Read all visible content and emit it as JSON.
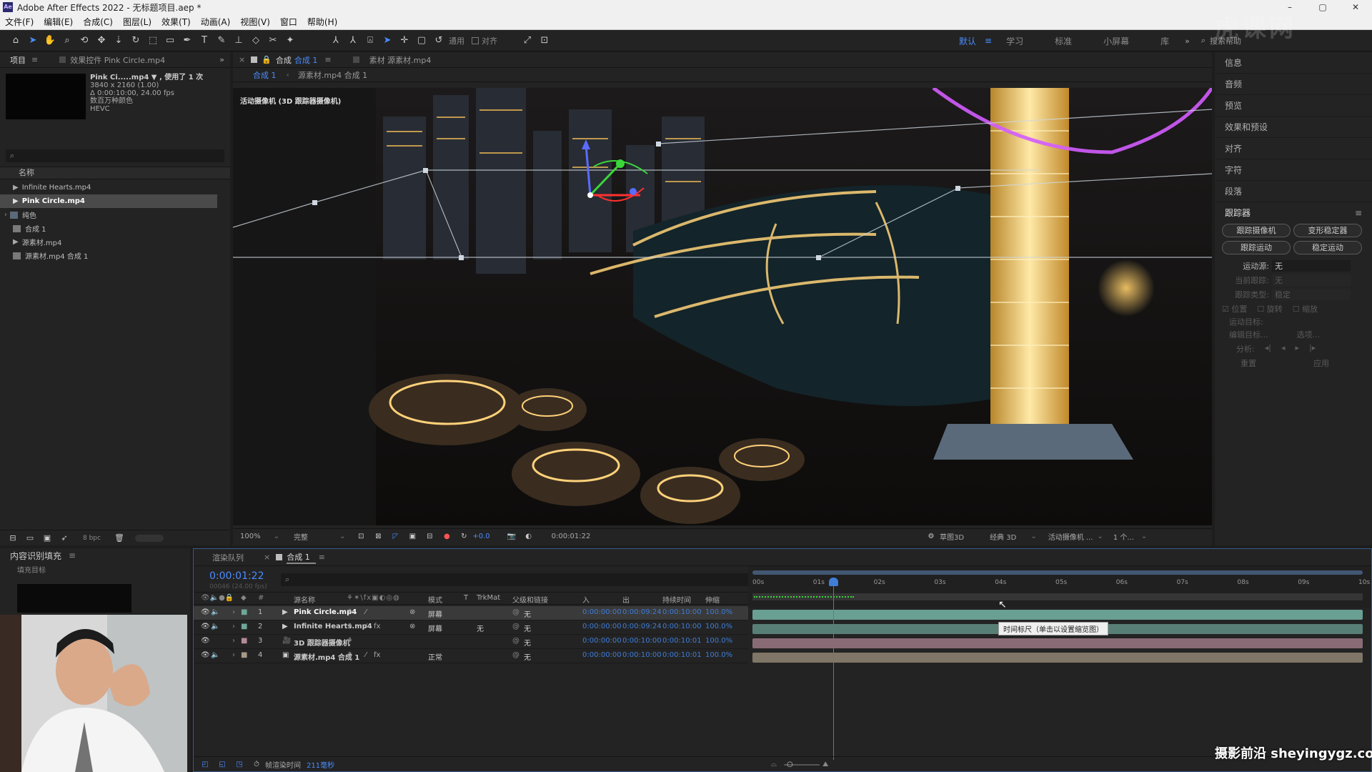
{
  "window": {
    "title": "Adobe After Effects 2022 - 无标题项目.aep *",
    "logo": "Ae",
    "controls": [
      "–",
      "▢",
      "✕"
    ]
  },
  "menu": [
    "文件(F)",
    "编辑(E)",
    "合成(C)",
    "图层(L)",
    "效果(T)",
    "动画(A)",
    "视图(V)",
    "窗口",
    "帮助(H)"
  ],
  "toolbar": {
    "snap_label": "通用",
    "align_label": "对齐",
    "workspaces": [
      "默认",
      "学习",
      "标准",
      "小屏幕",
      "库"
    ],
    "active_workspace": "默认",
    "search_placeholder": "搜索帮助"
  },
  "project": {
    "tab_label": "项目",
    "effects_tab": "效果控件 Pink Circle.mp4",
    "thumb_info": {
      "name": "Pink Ci.....mp4 ▼ , 使用了 1 次",
      "size": "3840 x 2160 (1.00)",
      "duration": "Δ 0:00:10:00, 24.00 fps",
      "colors": "数百万种颜色",
      "codec": "HEVC"
    },
    "search_placeholder": "",
    "column_name": "名称",
    "items": [
      {
        "label": "Infinite Hearts.mp4",
        "type": "footage",
        "selected": false
      },
      {
        "label": "Pink Circle.mp4",
        "type": "footage",
        "selected": true
      },
      {
        "label": "纯色",
        "type": "folder",
        "selected": false
      },
      {
        "label": "合成 1",
        "type": "comp",
        "selected": false
      },
      {
        "label": "源素材.mp4",
        "type": "footage",
        "selected": false
      },
      {
        "label": "源素材.mp4 合成 1",
        "type": "comp",
        "selected": false
      }
    ],
    "bpc": "8 bpc"
  },
  "composition": {
    "tab_comp": "合成",
    "tab_comp_name": "合成 1",
    "tab_footage": "素材 源素材.mp4",
    "breadcrumb": [
      "合成 1",
      "源素材.mp4 合成 1"
    ],
    "camera_label": "活动摄像机 (3D 跟踪器摄像机)",
    "zoom": "100%",
    "quality": "完整",
    "exposure": "+0.0",
    "timecode": "0:00:01:22",
    "renderer_draft": "草图3D",
    "renderer": "经典 3D",
    "view_camera": "活动摄像机 ...",
    "views": "1 个..."
  },
  "right_panel": {
    "items": [
      "信息",
      "音频",
      "预览",
      "效果和预设",
      "对齐",
      "字符",
      "段落"
    ],
    "tracker": {
      "title": "跟踪器",
      "buttons": [
        "跟踪摄像机",
        "变形稳定器",
        "跟踪运动",
        "稳定运动"
      ],
      "motion_source_label": "运动源:",
      "motion_source_value": "无",
      "current_track_label": "当前跟踪:",
      "current_track_value": "无",
      "track_type_label": "跟踪类型:",
      "track_type_value": "稳定",
      "checks": [
        "位置",
        "旋转",
        "缩放"
      ],
      "motion_target": "运动目标:",
      "edit_target": "编辑目标...",
      "options": "选项...",
      "analyze": "分析:",
      "reset": "重置",
      "apply": "应用"
    }
  },
  "content_fill": {
    "title": "内容识别填充",
    "fill_target": "填充目标"
  },
  "timeline": {
    "tab_render": "渲染队列",
    "tab_comp": "合成 1",
    "timecode": "0:00:01:22",
    "frame_info": "00046 (24.00 fps)",
    "search_placeholder": "",
    "headers": {
      "source_name": "源名称",
      "mode": "模式",
      "t": "T",
      "trkmat": "TrkMat",
      "parent": "父级和链接",
      "in": "入",
      "out": "出",
      "duration": "持续时间",
      "stretch": "伸缩"
    },
    "layers": [
      {
        "num": "1",
        "name": "Pink Circle.mp4",
        "mode": "屏幕",
        "trkmat": "",
        "parent": "无",
        "in": "0:00:00:00",
        "out": "0:00:09:24",
        "dur": "0:00:10:00",
        "stretch": "100.0%",
        "color": "#6fa79a",
        "selected": true
      },
      {
        "num": "2",
        "name": "Infinite Hearts.mp4",
        "mode": "屏幕",
        "trkmat": "无",
        "parent": "无",
        "in": "0:00:00:00",
        "out": "0:00:09:24",
        "dur": "0:00:10:00",
        "stretch": "100.0%",
        "color": "#6fa79a",
        "selected": false
      },
      {
        "num": "3",
        "name": "3D 跟踪器摄像机",
        "mode": "",
        "trkmat": "",
        "parent": "无",
        "in": "0:00:00:00",
        "out": "0:00:10:00",
        "dur": "0:00:10:01",
        "stretch": "100.0%",
        "color": "#b58a9a",
        "selected": false
      },
      {
        "num": "4",
        "name": "源素材.mp4 合成 1",
        "mode": "正常",
        "trkmat": "",
        "parent": "无",
        "in": "0:00:00:00",
        "out": "0:00:10:00",
        "dur": "0:00:10:01",
        "stretch": "100.0%",
        "color": "#a89a85",
        "selected": false
      }
    ],
    "ruler": [
      "00s",
      "01s",
      "02s",
      "03s",
      "04s",
      "05s",
      "06s",
      "07s",
      "08s",
      "09s",
      "10s"
    ],
    "tooltip": "时间标尺（单击以设置缩览图）",
    "render_time_label": "帧渲染时间",
    "render_time_value": "211毫秒"
  },
  "watermark": {
    "text": "摄影前沿 sheyingygz.com",
    "top_mark": "虎课网"
  }
}
